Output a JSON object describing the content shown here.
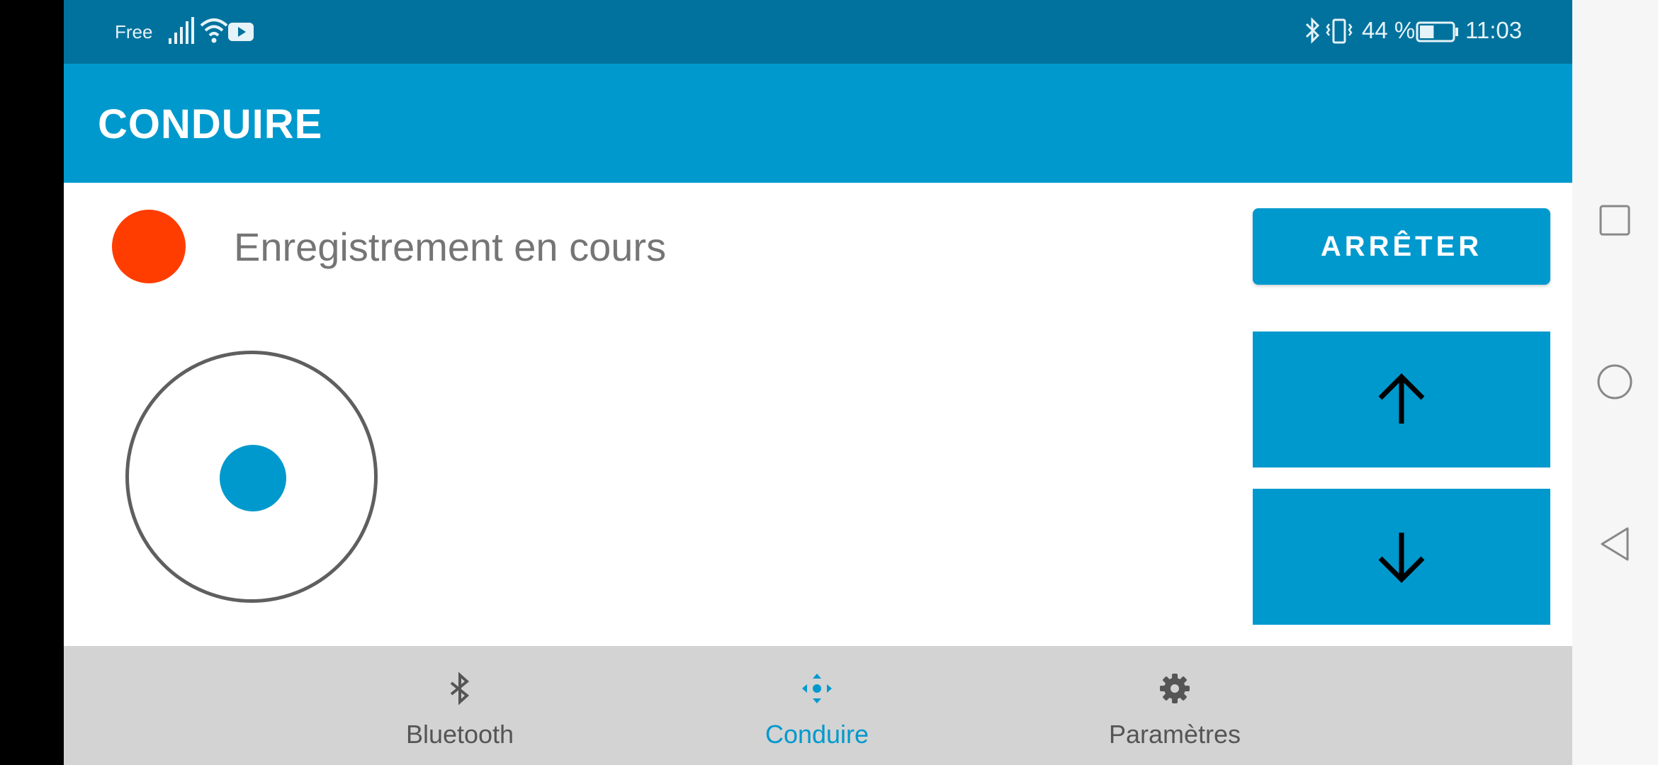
{
  "status_bar": {
    "carrier": "Free",
    "battery_percent": "44 %",
    "time": "11:03",
    "icons": [
      "signal-icon",
      "wifi-icon",
      "youtube-icon",
      "bluetooth-icon",
      "vibrate-icon",
      "battery-icon"
    ],
    "battery_level": 0.44
  },
  "app_bar": {
    "title": "CONDUIRE"
  },
  "recording": {
    "status_text": "Enregistrement en cours",
    "indicator_color": "#ff3d00"
  },
  "controls": {
    "stop_label": "ARRÊTER",
    "up_icon": "arrow-up-icon",
    "down_icon": "arrow-down-icon",
    "joystick_icon": "joystick"
  },
  "bottom_nav": {
    "items": [
      {
        "label": "Bluetooth",
        "icon": "bluetooth-icon",
        "active": false
      },
      {
        "label": "Conduire",
        "icon": "drive-icon",
        "active": true
      },
      {
        "label": "Paramètres",
        "icon": "gear-icon",
        "active": false
      }
    ]
  },
  "system_nav": {
    "icons": [
      "recents-icon",
      "home-icon",
      "back-icon"
    ]
  },
  "colors": {
    "accent": "#0099cd",
    "status_bar": "#01729d",
    "nav_bg": "#d3d3d3"
  }
}
